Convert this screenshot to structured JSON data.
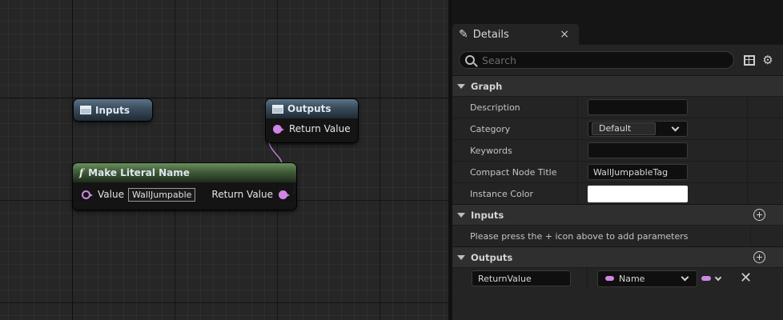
{
  "graph": {
    "inputs_node": {
      "title": "Inputs"
    },
    "outputs_node": {
      "title": "Outputs",
      "pin_label": "Return Value"
    },
    "make_literal_node": {
      "title": "Make Literal Name",
      "icon_glyph": "f",
      "input_label": "Value",
      "input_value": "WallJumpable",
      "output_label": "Return Value"
    },
    "pin_color": "#d285e6"
  },
  "details": {
    "tab": {
      "label": "Details",
      "icon": "pencil-icon",
      "close_glyph": "×"
    },
    "search": {
      "placeholder": "Search"
    },
    "graph_section": {
      "title": "Graph",
      "rows": {
        "description": {
          "label": "Description",
          "value": ""
        },
        "category": {
          "label": "Category",
          "value": "Default"
        },
        "keywords": {
          "label": "Keywords",
          "value": ""
        },
        "compact_title": {
          "label": "Compact Node Title",
          "value": "WallJumpableTag"
        },
        "instance_color": {
          "label": "Instance Color",
          "value": "#ffffff"
        }
      }
    },
    "inputs_section": {
      "title": "Inputs",
      "hint": "Please press the + icon above to add parameters"
    },
    "outputs_section": {
      "title": "Outputs",
      "param": {
        "name": "ReturnValue",
        "type": "Name"
      }
    }
  }
}
